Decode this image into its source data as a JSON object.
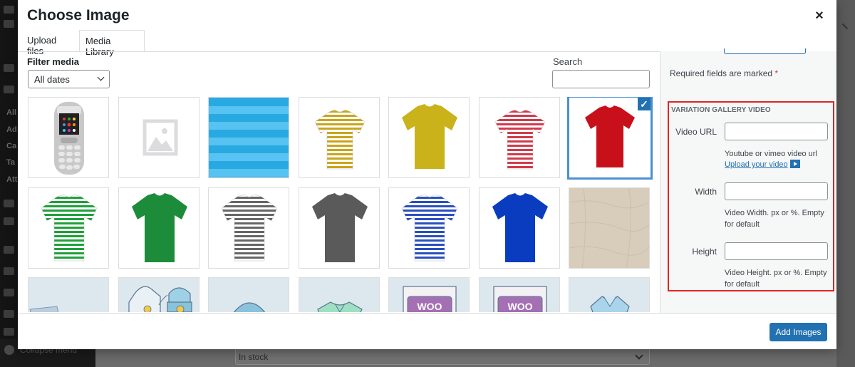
{
  "modal": {
    "title": "Choose Image",
    "close_symbol": "×"
  },
  "tabs": [
    {
      "label": "Upload files"
    },
    {
      "label": "Media Library"
    }
  ],
  "filter": {
    "label": "Filter media",
    "date_value": "All dates"
  },
  "search": {
    "label": "Search",
    "value": ""
  },
  "media_items": [
    {
      "name": "nokia-phone"
    },
    {
      "name": "placeholder-image"
    },
    {
      "name": "blue-stripes"
    },
    {
      "name": "yellow-striped-tshirt"
    },
    {
      "name": "yellow-tshirt"
    },
    {
      "name": "red-striped-tshirt"
    },
    {
      "name": "red-tshirt",
      "selected": true
    },
    {
      "name": "green-striped-tshirt"
    },
    {
      "name": "green-tshirt"
    },
    {
      "name": "gray-striped-tshirt"
    },
    {
      "name": "gray-tshirt"
    },
    {
      "name": "blue-striped-tshirt"
    },
    {
      "name": "blue-tshirt"
    },
    {
      "name": "beige-fabric"
    },
    {
      "name": "jeans-sketch"
    },
    {
      "name": "hoodie-beanie-sketch"
    },
    {
      "name": "cap-sketch"
    },
    {
      "name": "shirt-sketch"
    },
    {
      "name": "woo-poster-1"
    },
    {
      "name": "woo-poster-2"
    },
    {
      "name": "polo-sketch"
    }
  ],
  "sidebar": {
    "required_text": "Required fields are marked",
    "required_star": "*",
    "video_section": {
      "title": "VARIATION GALLERY VIDEO",
      "video_url_label": "Video URL",
      "video_url_value": "",
      "video_url_help": "Youtube or vimeo video url",
      "upload_link": "Upload your video",
      "width_label": "Width",
      "width_value": "",
      "width_help": "Video Width. px or %. Empty for default",
      "height_label": "Height",
      "height_value": "",
      "height_help": "Video Height. px or %. Empty for default"
    }
  },
  "footer": {
    "add_button": "Add Images"
  },
  "background": {
    "stock_select": "In stock",
    "collapse_menu": "Collapse menu",
    "sidebar_letters": [
      "All",
      "Ad",
      "Ca",
      "Ta",
      "Att"
    ]
  },
  "colors": {
    "accent": "#2271b1",
    "highlight_box": "#e02424",
    "selected_border": "#4a90d6"
  }
}
